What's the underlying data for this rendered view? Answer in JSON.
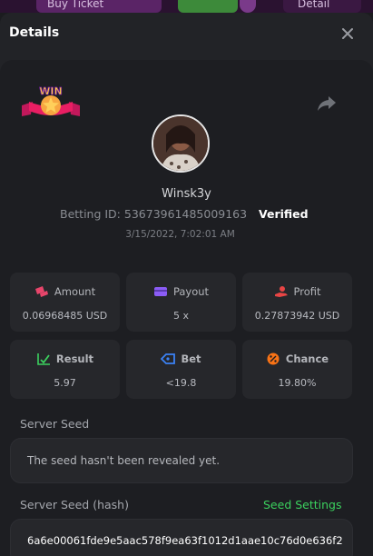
{
  "background": {
    "left_label": "Buy Ticket",
    "right_label": "Detail"
  },
  "modal": {
    "title": "Details"
  },
  "bet": {
    "badge_text": "WIN",
    "username": "Winsk3y",
    "betting_id_label": "Betting ID:",
    "betting_id": "53673961485009163",
    "verified_label": "Verified",
    "datetime": "3/15/2022, 7:02:01 AM"
  },
  "stats": [
    {
      "label": "Amount",
      "value": "0.06968485 USD",
      "icon": "coins-icon",
      "color": "#e8456b"
    },
    {
      "label": "Payout",
      "value": "5 x",
      "icon": "wallet-icon",
      "color": "#8b5cf6"
    },
    {
      "label": "Profit",
      "value": "0.27873942 USD",
      "icon": "hand-coin-icon",
      "color": "#e84545"
    },
    {
      "label": "Result",
      "value": "5.97",
      "icon": "chart-check-icon",
      "color": "#3bd15e"
    },
    {
      "label": "Bet",
      "value": "<19.8",
      "icon": "tag-icon",
      "color": "#3b82f6"
    },
    {
      "label": "Chance",
      "value": "19.80%",
      "icon": "percent-icon",
      "color": "#f97316"
    }
  ],
  "server_seed": {
    "label": "Server Seed",
    "value": "The seed hasn't been revealed yet."
  },
  "server_seed_hash": {
    "label": "Server Seed (hash)",
    "settings_link": "Seed Settings",
    "value": "6a6e00061fde9e5aac578f9ea63f1012d1aae10c76d0e636f2"
  }
}
